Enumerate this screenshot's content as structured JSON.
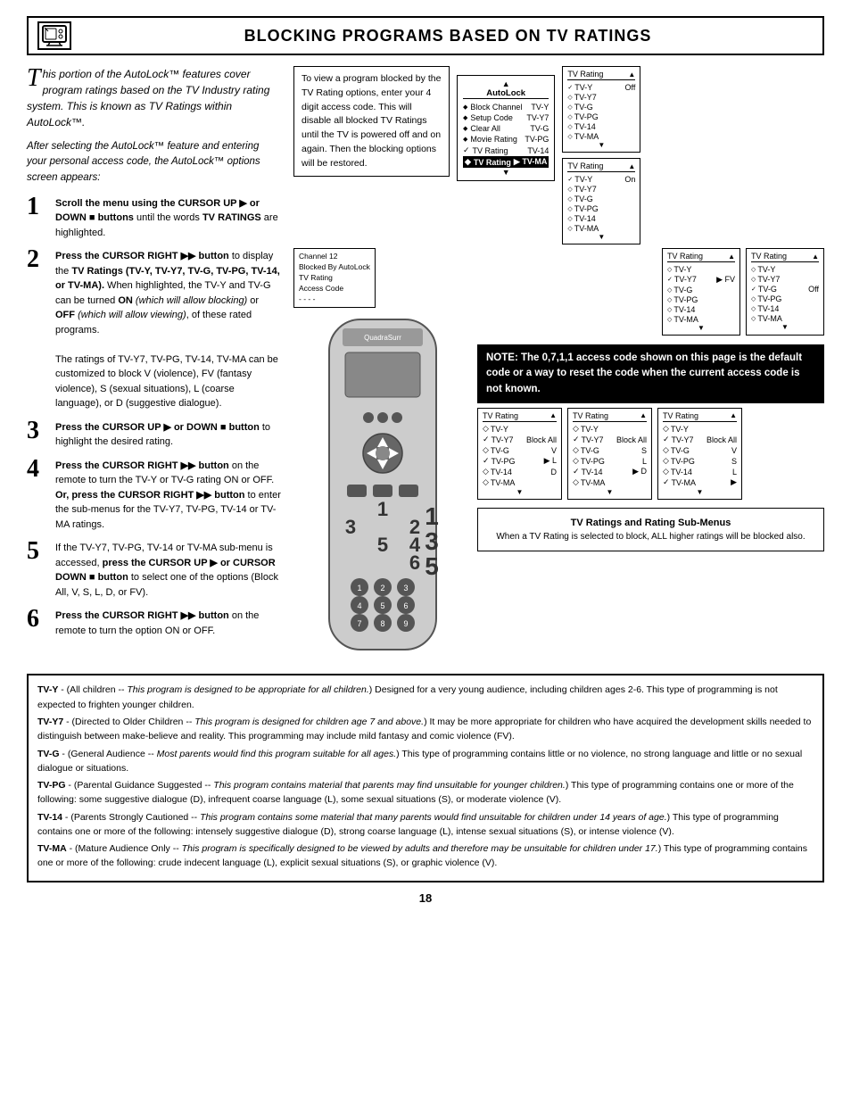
{
  "header": {
    "title": "Blocking Programs Based on TV Ratings",
    "icon": "📺"
  },
  "intro": {
    "paragraph1": "his portion of the AutoLock™ features cover program ratings based on the TV Industry rating system. This is known as TV Ratings within AutoLock™.",
    "paragraph2": "After selecting the AutoLock™ feature and entering your personal access code, the AutoLock™ options screen appears:"
  },
  "steps": [
    {
      "num": "1",
      "text_bold": "Scroll the menu using the CURSOR UP",
      "text_after": " or DOWN",
      "text_rest": " buttons until the words TV RATINGS are highlighted."
    },
    {
      "num": "2",
      "text": "Press the CURSOR RIGHT  button to display the TV Ratings (TV-Y, TV-Y7, TV-G, TV-PG, TV-14, or TV-MA). When highlighted, the TV-Y and TV-G can be turned ON (which will allow blocking) or OFF (which will allow viewing), of these rated programs.",
      "text2": "The ratings of TV-Y7, TV-PG, TV-14, TV-MA can be customized to block V (violence), FV (fantasy violence), S (sexual situations), L (coarse language), or D (suggestive dialogue)."
    },
    {
      "num": "3",
      "text": "Press the CURSOR UP  or DOWN  button to highlight the desired rating."
    },
    {
      "num": "4",
      "text": "Press the CURSOR RIGHT  button on the remote to turn the TV-Y or TV-G rating ON or OFF. Or, press the CURSOR RIGHT  button to enter the sub-menus for the TV-Y7, TV-PG, TV-14 or TV-MA ratings."
    },
    {
      "num": "5",
      "text": "If the TV-Y7, TV-PG, TV-14 or TV-MA sub-menu is accessed, press the CURSOR UP  or CURSOR DOWN  button to select one of the options (Block All, V, S, L, D, or FV)."
    },
    {
      "num": "6",
      "text": "Press the CURSOR RIGHT  button on the remote to turn the option ON or OFF."
    }
  ],
  "desc_box": {
    "text": "To view a program blocked by the TV Rating options, enter your 4 digit access code. This will disable all blocked TV Ratings until the TV is powered off and on again. Then the blocking options will be restored."
  },
  "autolock_menu": {
    "title": "AutoLock",
    "up_arrow": "▲",
    "items": [
      {
        "diamond": true,
        "label": "Block Channel",
        "value": "TV-Y"
      },
      {
        "diamond": true,
        "label": "Setup Code",
        "value": "TV-Y7"
      },
      {
        "diamond": true,
        "label": "Clear All",
        "value": "TV-G"
      },
      {
        "diamond": true,
        "label": "Movie Rating",
        "value": "TV-PG"
      },
      {
        "check": true,
        "label": "TV Rating",
        "value": "TV-14",
        "arrow": true
      },
      {
        "selected": true,
        "label": "TV Rating",
        "value": "TV-MA",
        "arrow": true
      }
    ],
    "down_arrow": "▼"
  },
  "rating_menus_right_top": [
    {
      "title": "TV Rating",
      "up": "▲",
      "items": [
        {
          "check": true,
          "label": "TV-Y",
          "value": "Off"
        },
        {
          "diamond": true,
          "label": "TV-Y7"
        },
        {
          "diamond": true,
          "label": "TV-G"
        },
        {
          "diamond": true,
          "label": "TV-PG"
        },
        {
          "diamond": true,
          "label": "TV-14"
        },
        {
          "diamond": true,
          "label": "TV-MA"
        }
      ],
      "down": "▼"
    },
    {
      "title": "TV Rating",
      "up": "▲",
      "items": [
        {
          "check": true,
          "label": "TV-Y",
          "value": "On"
        },
        {
          "diamond": true,
          "label": "TV-Y7"
        },
        {
          "diamond": true,
          "label": "TV-G"
        },
        {
          "diamond": true,
          "label": "TV-PG"
        },
        {
          "diamond": true,
          "label": "TV-14"
        },
        {
          "diamond": true,
          "label": "TV-MA"
        }
      ],
      "down": "▼"
    },
    {
      "title": "TV Rating",
      "up": "▲",
      "items": [
        {
          "diamond": true,
          "label": "TV-Y"
        },
        {
          "check": true,
          "label": "TV-Y7",
          "arrow": true,
          "value": "FV"
        },
        {
          "diamond": true,
          "label": "TV-G"
        },
        {
          "diamond": true,
          "label": "TV-PG"
        },
        {
          "diamond": true,
          "label": "TV-14"
        },
        {
          "diamond": true,
          "label": "TV-MA"
        }
      ],
      "down": "▼"
    },
    {
      "title": "TV Rating",
      "up": "▲",
      "items": [
        {
          "diamond": true,
          "label": "TV-Y"
        },
        {
          "diamond": true,
          "label": "TV-Y7"
        },
        {
          "check": true,
          "label": "TV-G",
          "value": "Off"
        },
        {
          "diamond": true,
          "label": "TV-PG"
        },
        {
          "diamond": true,
          "label": "TV-14"
        },
        {
          "diamond": true,
          "label": "TV-MA"
        }
      ],
      "down": "▼"
    }
  ],
  "channel_info": {
    "line1": "Channel 12",
    "line2": "Blocked By AutoLock",
    "line3": "TV Rating",
    "line4": "Access Code",
    "line5": "- - - -"
  },
  "note": {
    "text": "NOTE: The 0,7,1,1 access code shown on this page is the default code or a way to reset the code when the current access code is not known."
  },
  "bottom_menus": [
    {
      "title": "TV Rating",
      "up": "▲",
      "items": [
        {
          "diamond": true,
          "label": "TV-Y"
        },
        {
          "check": true,
          "label": "TV-Y7",
          "value": "Block All"
        },
        {
          "diamond": true,
          "label": "TV-G",
          "value": "V"
        },
        {
          "check": true,
          "label": "TV-PG",
          "arrow": true,
          "value": "L"
        },
        {
          "diamond": true,
          "label": "TV-14",
          "value": "D"
        },
        {
          "diamond": true,
          "label": "TV-MA"
        }
      ],
      "down": "▼"
    },
    {
      "title": "TV Rating",
      "up": "▲",
      "items": [
        {
          "diamond": true,
          "label": "TV-Y"
        },
        {
          "check": true,
          "label": "TV-Y7",
          "value": "Block All"
        },
        {
          "diamond": true,
          "label": "TV-G",
          "value": "S"
        },
        {
          "diamond": true,
          "label": "TV-PG",
          "value": "L"
        },
        {
          "check": true,
          "label": "TV-14",
          "arrow": true,
          "value": "D"
        },
        {
          "diamond": true,
          "label": "TV-MA"
        }
      ],
      "down": "▼"
    },
    {
      "title": "TV Rating",
      "up": "▲",
      "items": [
        {
          "diamond": true,
          "label": "TV-Y"
        },
        {
          "check": true,
          "label": "TV-Y7",
          "value": "Block All"
        },
        {
          "diamond": true,
          "label": "TV-G",
          "value": "V"
        },
        {
          "diamond": true,
          "label": "TV-PG",
          "value": "S"
        },
        {
          "diamond": true,
          "label": "TV-14",
          "value": "L"
        },
        {
          "check": true,
          "label": "TV-MA",
          "arrow": true
        }
      ],
      "down": "▼"
    }
  ],
  "rating_desc": {
    "title": "TV Ratings and Rating Sub-Menus",
    "text": "When a TV Rating is selected to block, ALL higher ratings will be blocked also."
  },
  "definitions": [
    {
      "key": "TV-Y",
      "bold": "TV-Y",
      "text": " - (All children -- This program is designed to be appropriate for all children.) Designed for a very young audience, including children ages 2-6. This type of programming is not expected to frighten younger children."
    },
    {
      "key": "TV-Y7",
      "bold": "TV-Y7",
      "text": " - (Directed to Older Children -- This program is designed for children age 7 and above.) It may be more appropriate for children who have acquired the development skills needed to distinguish between make-believe and reality. This programming may include mild fantasy and comic violence (FV)."
    },
    {
      "key": "TV-G",
      "bold": "TV-G",
      "text": " - (General Audience -- Most parents would find this program suitable for all ages.) This type of programming contains little or no violence, no strong language and little or no sexual dialogue or situations."
    },
    {
      "key": "TV-PG",
      "bold": "TV-PG",
      "text": " - (Parental Guidance Suggested -- This program contains material that parents may find unsuitable for younger children.) This type of programming contains one or more of the following: some suggestive dialogue (D), infrequent coarse language (L), some sexual situations (S), or moderate violence (V)."
    },
    {
      "key": "TV-14",
      "bold": "TV-14",
      "text": " - (Parents Strongly Cautioned -- This program contains some material that many parents would find unsuitable for children under 14 years of age.) This type of programming contains one or more of the following: intensely suggestive dialogue (D), strong coarse language (L), intense sexual situations (S), or intense violence (V)."
    },
    {
      "key": "TV-MA",
      "bold": "TV-MA",
      "text": " - (Mature Audience Only -- This program is specifically designed to be viewed by adults and therefore may be unsuitable for children under 17.) This type of programming contains one or more of the following: crude indecent language (L), explicit sexual situations (S), or graphic violence (V)."
    }
  ],
  "page_number": "18"
}
